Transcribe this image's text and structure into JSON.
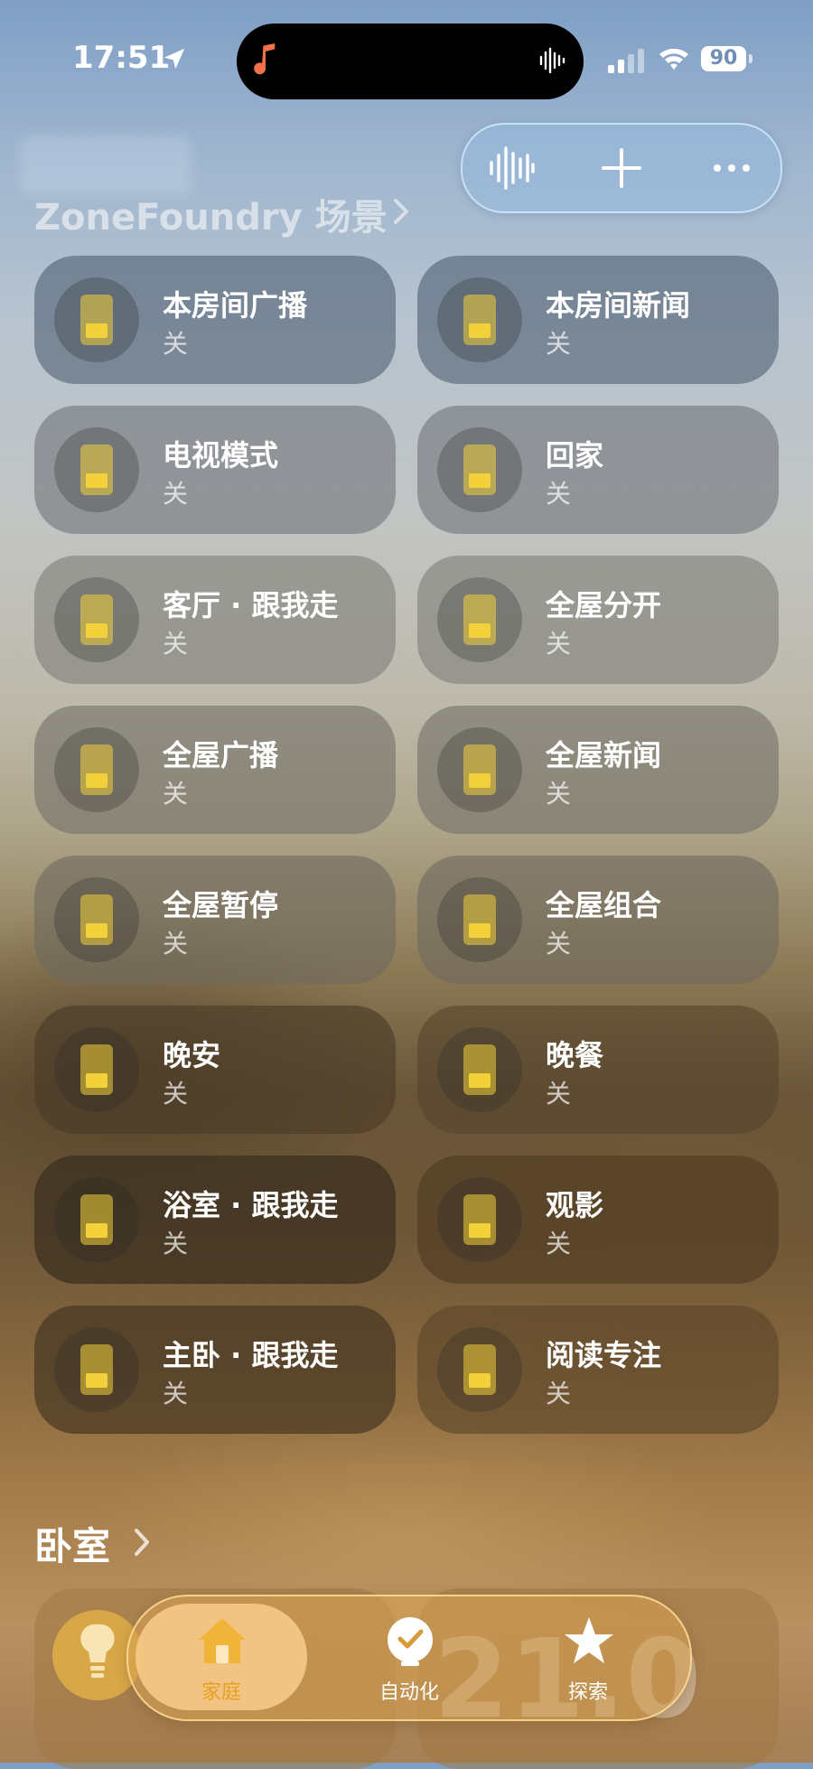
{
  "status_bar": {
    "time": "17:51",
    "battery": "90"
  },
  "section": {
    "title": "ZoneFoundry 场景"
  },
  "scenes": [
    {
      "name": "本房间广播",
      "state": "关"
    },
    {
      "name": "本房间新闻",
      "state": "关"
    },
    {
      "name": "电视模式",
      "state": "关"
    },
    {
      "name": "回家",
      "state": "关"
    },
    {
      "name": "客厅 · 跟我走",
      "state": "关"
    },
    {
      "name": "全屋分开",
      "state": "关"
    },
    {
      "name": "全屋广播",
      "state": "关"
    },
    {
      "name": "全屋新闻",
      "state": "关"
    },
    {
      "name": "全屋暂停",
      "state": "关"
    },
    {
      "name": "全屋组合",
      "state": "关"
    },
    {
      "name": "晚安",
      "state": "关"
    },
    {
      "name": "晚餐",
      "state": "关"
    },
    {
      "name": "浴室 · 跟我走",
      "state": "关"
    },
    {
      "name": "观影",
      "state": "关"
    },
    {
      "name": "主卧 · 跟我走",
      "state": "关"
    },
    {
      "name": "阅读专注",
      "state": "关"
    }
  ],
  "room": {
    "title": "卧室",
    "temperature": "21.0"
  },
  "tabs": [
    {
      "label": "家庭",
      "active": true
    },
    {
      "label": "自动化",
      "active": false
    },
    {
      "label": "探索",
      "active": false
    }
  ],
  "icons": {
    "location": "location-arrow-icon",
    "music": "music-note-icon",
    "voice": "waveform-icon",
    "add": "plus-icon",
    "more": "ellipsis-icon",
    "scene": "scene-tile-icon",
    "bulb": "lightbulb-icon",
    "home": "house-icon",
    "automation": "clock-check-icon",
    "explore": "star-icon"
  },
  "colors": {
    "accent": "#e8a020",
    "scene_icon": "#f3d13a",
    "music_icon": "#f2704a"
  }
}
